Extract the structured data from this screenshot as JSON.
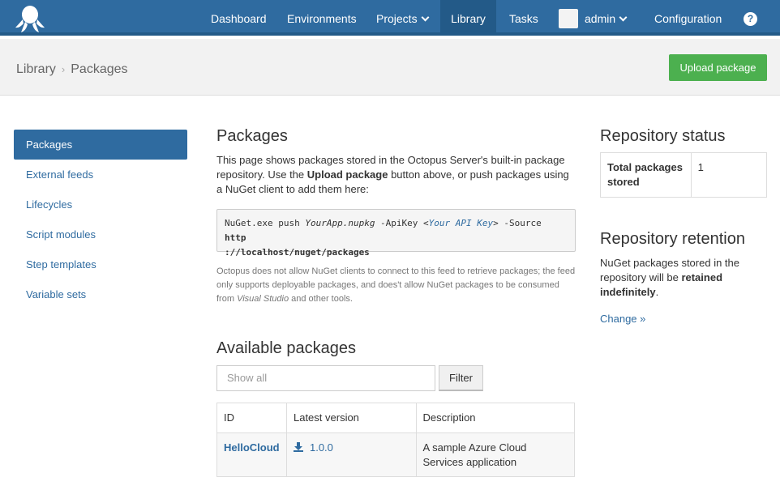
{
  "nav": {
    "items": [
      "Dashboard",
      "Environments",
      "Projects",
      "Library",
      "Tasks",
      "admin",
      "Configuration"
    ],
    "help": "?"
  },
  "header": {
    "breadcrumb": [
      "Library",
      "Packages"
    ],
    "upload_label": "Upload package"
  },
  "sidebar": {
    "items": [
      "Packages",
      "External feeds",
      "Lifecycles",
      "Script modules",
      "Step templates",
      "Variable sets"
    ],
    "active": "Packages"
  },
  "main": {
    "title": "Packages",
    "intro_a": "This page shows packages stored in the Octopus Server's built-in package repository. Use the ",
    "intro_bold": "Upload package",
    "intro_b": " button above, or push packages using a NuGet client to add them here:",
    "code": {
      "cmd": "NuGet.exe push ",
      "app": "YourApp.nupkg",
      "apikey_flag": " -ApiKey <",
      "apikey": "Your API Key",
      "source_flag": "> -Source ",
      "url_a": "http",
      "url_b": "://localhost/nuget/packages"
    },
    "note_a": "Octopus does not allow NuGet clients to connect to this feed to retrieve packages; the feed only supports deployable packages, and does't allow NuGet packages to be consumed from ",
    "note_em": "Visual Studio",
    "note_b": " and other tools.",
    "available_title": "Available packages",
    "search_placeholder": "Show all",
    "filter_label": "Filter",
    "table": {
      "headers": [
        "ID",
        "Latest version",
        "Description"
      ],
      "rows": [
        {
          "id": "HelloCloud",
          "version": "1.0.0",
          "description": "A sample Azure Cloud Services application"
        }
      ]
    }
  },
  "right": {
    "status_title": "Repository status",
    "total_label": "Total packages stored",
    "total_value": "1",
    "retention_title": "Repository retention",
    "retention_a": "NuGet packages stored in the repository will be ",
    "retention_bold": "retained indefinitely",
    "retention_b": ".",
    "change_label": "Change »"
  },
  "colors": {
    "nav": "#2f6ba0",
    "accent": "#2f6ba0",
    "upload": "#4cb04f"
  }
}
